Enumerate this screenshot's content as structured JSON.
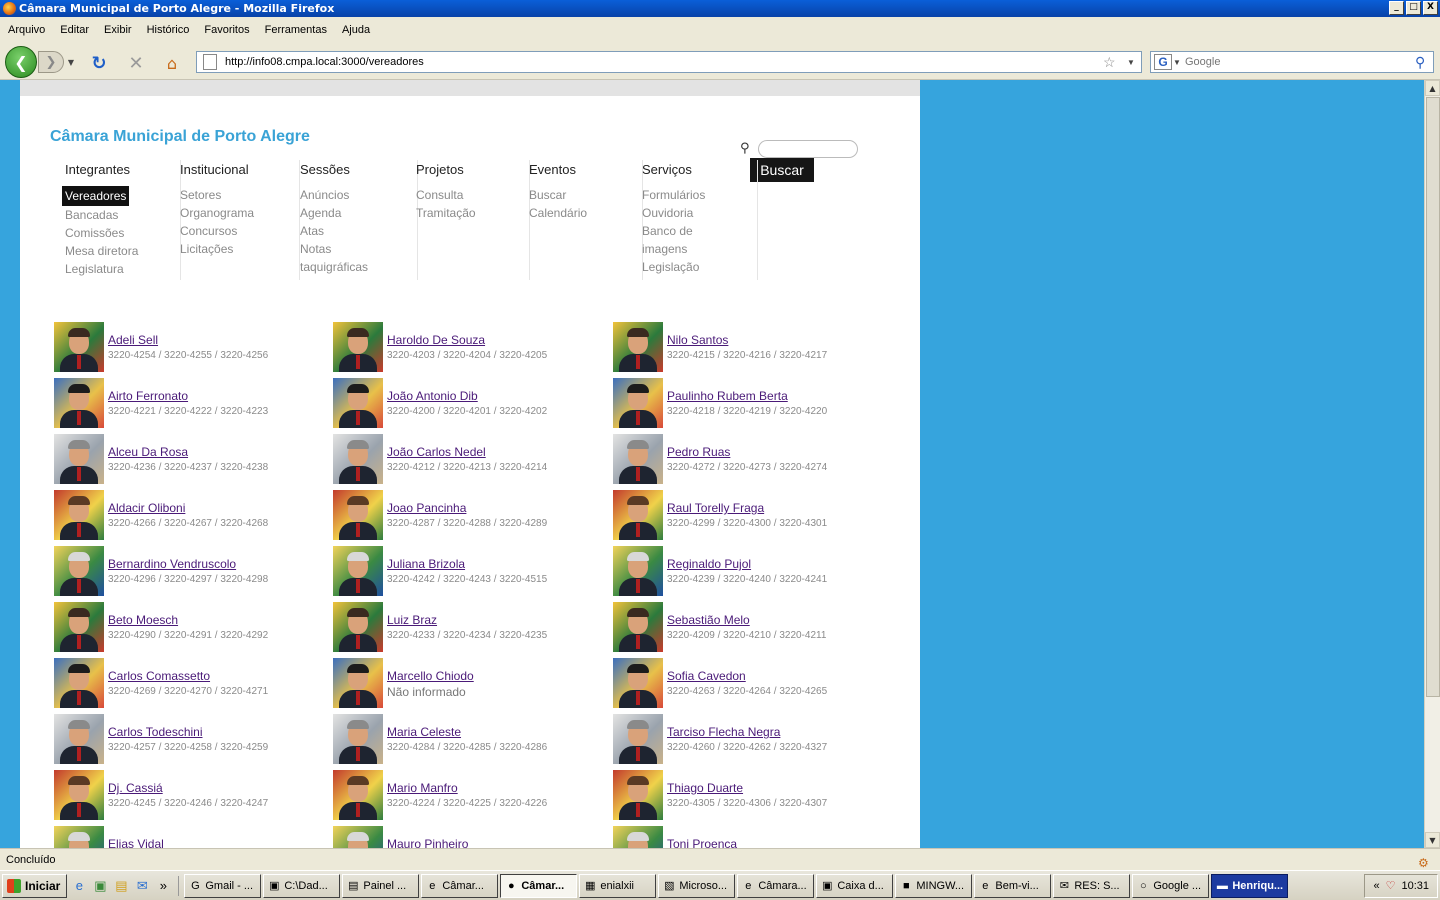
{
  "window": {
    "title": "Câmara Municipal de Porto Alegre - Mozilla Firefox",
    "min_label": "_",
    "max_label": "□",
    "close_label": "X"
  },
  "menubar": [
    "Arquivo",
    "Editar",
    "Exibir",
    "Histórico",
    "Favoritos",
    "Ferramentas",
    "Ajuda"
  ],
  "toolbar": {
    "url": "http://info08.cmpa.local:3000/vereadores",
    "search_placeholder": "Google",
    "icons": [
      "back-icon",
      "forward-icon",
      "reload-icon",
      "stop-icon",
      "home-icon",
      "star-icon",
      "search-icon"
    ]
  },
  "site": {
    "title": "Câmara Municipal de Porto Alegre",
    "search_button": "Buscar"
  },
  "nav": [
    {
      "head": "Integrantes",
      "items": [
        "Vereadores",
        "Bancadas",
        "Comissões",
        "Mesa diretora",
        "Legislatura"
      ],
      "active": 0
    },
    {
      "head": "Institucional",
      "items": [
        "Setores",
        "Organograma",
        "Concursos",
        "Licitações"
      ]
    },
    {
      "head": "Sessões",
      "items": [
        "Anúncios",
        "Agenda",
        "Atas",
        "Notas",
        "taquigráficas"
      ]
    },
    {
      "head": "Projetos",
      "items": [
        "Consulta",
        "Tramitação"
      ]
    },
    {
      "head": "Eventos",
      "items": [
        "Buscar",
        "Calendário"
      ]
    },
    {
      "head": "Serviços",
      "items": [
        "Formulários",
        "Ouvidoria",
        "Banco de",
        "imagens",
        "Legislação"
      ]
    }
  ],
  "vereadores": [
    {
      "name": "Adeli Sell",
      "phone": "3220-4254 / 3220-4255 / 3220-4256"
    },
    {
      "name": "Airto Ferronato",
      "phone": "3220-4221 / 3220-4222 / 3220-4223"
    },
    {
      "name": "Alceu Da Rosa",
      "phone": "3220-4236 / 3220-4237 / 3220-4238"
    },
    {
      "name": "Aldacir Oliboni",
      "phone": "3220-4266 / 3220-4267 / 3220-4268"
    },
    {
      "name": "Bernardino Vendruscolo",
      "phone": "3220-4296 / 3220-4297 / 3220-4298"
    },
    {
      "name": "Beto Moesch",
      "phone": "3220-4290 / 3220-4291 / 3220-4292"
    },
    {
      "name": "Carlos Comassetto",
      "phone": "3220-4269 / 3220-4270 / 3220-4271"
    },
    {
      "name": "Carlos Todeschini",
      "phone": "3220-4257 / 3220-4258 / 3220-4259"
    },
    {
      "name": "Dj. Cassiá",
      "phone": "3220-4245 / 3220-4246 / 3220-4247"
    },
    {
      "name": "Elias Vidal",
      "phone": ""
    },
    {
      "name": "Haroldo De Souza",
      "phone": "3220-4203 / 3220-4204 / 3220-4205"
    },
    {
      "name": "João Antonio Dib",
      "phone": "3220-4200 / 3220-4201 / 3220-4202"
    },
    {
      "name": "João Carlos Nedel",
      "phone": "3220-4212 / 3220-4213 / 3220-4214"
    },
    {
      "name": "Joao Pancinha",
      "phone": "3220-4287 / 3220-4288 / 3220-4289"
    },
    {
      "name": "Juliana Brizola",
      "phone": "3220-4242 / 3220-4243 / 3220-4515"
    },
    {
      "name": "Luiz Braz",
      "phone": "3220-4233 / 3220-4234 / 3220-4235"
    },
    {
      "name": "Marcello Chiodo",
      "phone": "Não informado"
    },
    {
      "name": "Maria Celeste",
      "phone": "3220-4284 / 3220-4285 / 3220-4286"
    },
    {
      "name": "Mario Manfro",
      "phone": "3220-4224 / 3220-4225 / 3220-4226"
    },
    {
      "name": "Mauro Pinheiro",
      "phone": ""
    },
    {
      "name": "Nilo Santos",
      "phone": "3220-4215 / 3220-4216 / 3220-4217"
    },
    {
      "name": "Paulinho Rubem Berta",
      "phone": "3220-4218 / 3220-4219 / 3220-4220"
    },
    {
      "name": "Pedro Ruas",
      "phone": "3220-4272 / 3220-4273 / 3220-4274"
    },
    {
      "name": "Raul Torelly Fraga",
      "phone": "3220-4299 / 3220-4300 / 3220-4301"
    },
    {
      "name": "Reginaldo Pujol",
      "phone": "3220-4239 / 3220-4240 / 3220-4241"
    },
    {
      "name": "Sebastião Melo",
      "phone": "3220-4209 / 3220-4210 / 3220-4211"
    },
    {
      "name": "Sofia Cavedon",
      "phone": "3220-4263 / 3220-4264 / 3220-4265"
    },
    {
      "name": "Tarciso Flecha Negra",
      "phone": "3220-4260 / 3220-4262 / 3220-4327"
    },
    {
      "name": "Thiago Duarte",
      "phone": "3220-4305 / 3220-4306 / 3220-4307"
    },
    {
      "name": "Toni Proenca",
      "phone": ""
    }
  ],
  "status": "Concluído",
  "taskbar": {
    "start": "Iniciar",
    "more": "»",
    "tasks": [
      "Gmail - ...",
      "C:\\Dad...",
      "Painel ...",
      "Câmar...",
      "Câmar...",
      "enialxii",
      "Microso...",
      "Câmara...",
      "Caixa d...",
      "MINGW...",
      "Bem-vi...",
      "RES: S...",
      "Google ...",
      "Henriqu..."
    ],
    "active_task": 4,
    "highlight_task": 13,
    "clock": "10:31",
    "tray_more": "«"
  }
}
